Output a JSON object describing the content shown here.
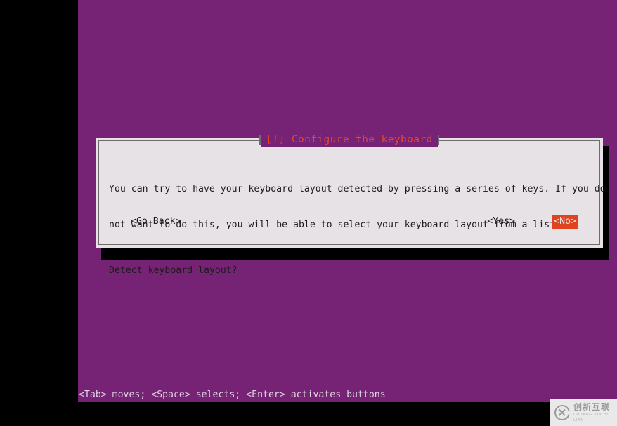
{
  "screen": {
    "background_color": "#000000",
    "console_background_color": "#762275"
  },
  "dialog": {
    "title": "[!] Configure the keyboard",
    "title_color": "#e8472c",
    "background_color": "#e6e2e6",
    "border_color": "#6e6a6e",
    "body_lines": [
      "You can try to have your keyboard layout detected by pressing a series of keys. If you do",
      "not want to do this, you will be able to select your keyboard layout from a list."
    ],
    "question": "Detect keyboard layout?",
    "buttons": {
      "go_back": "<Go Back>",
      "yes": "<Yes>",
      "no": "<No>",
      "selected": "<No>",
      "selected_background_color": "#e0431f",
      "selected_text_color": "#e6e2e6"
    }
  },
  "status_bar": {
    "text": "<Tab> moves; <Space> selects; <Enter> activates buttons",
    "text_color": "#ded5de"
  },
  "watermark": {
    "chinese": "创新互联",
    "pinyin": "CHUANG XIN HU LIAN",
    "icon": "cx-logo-icon"
  }
}
